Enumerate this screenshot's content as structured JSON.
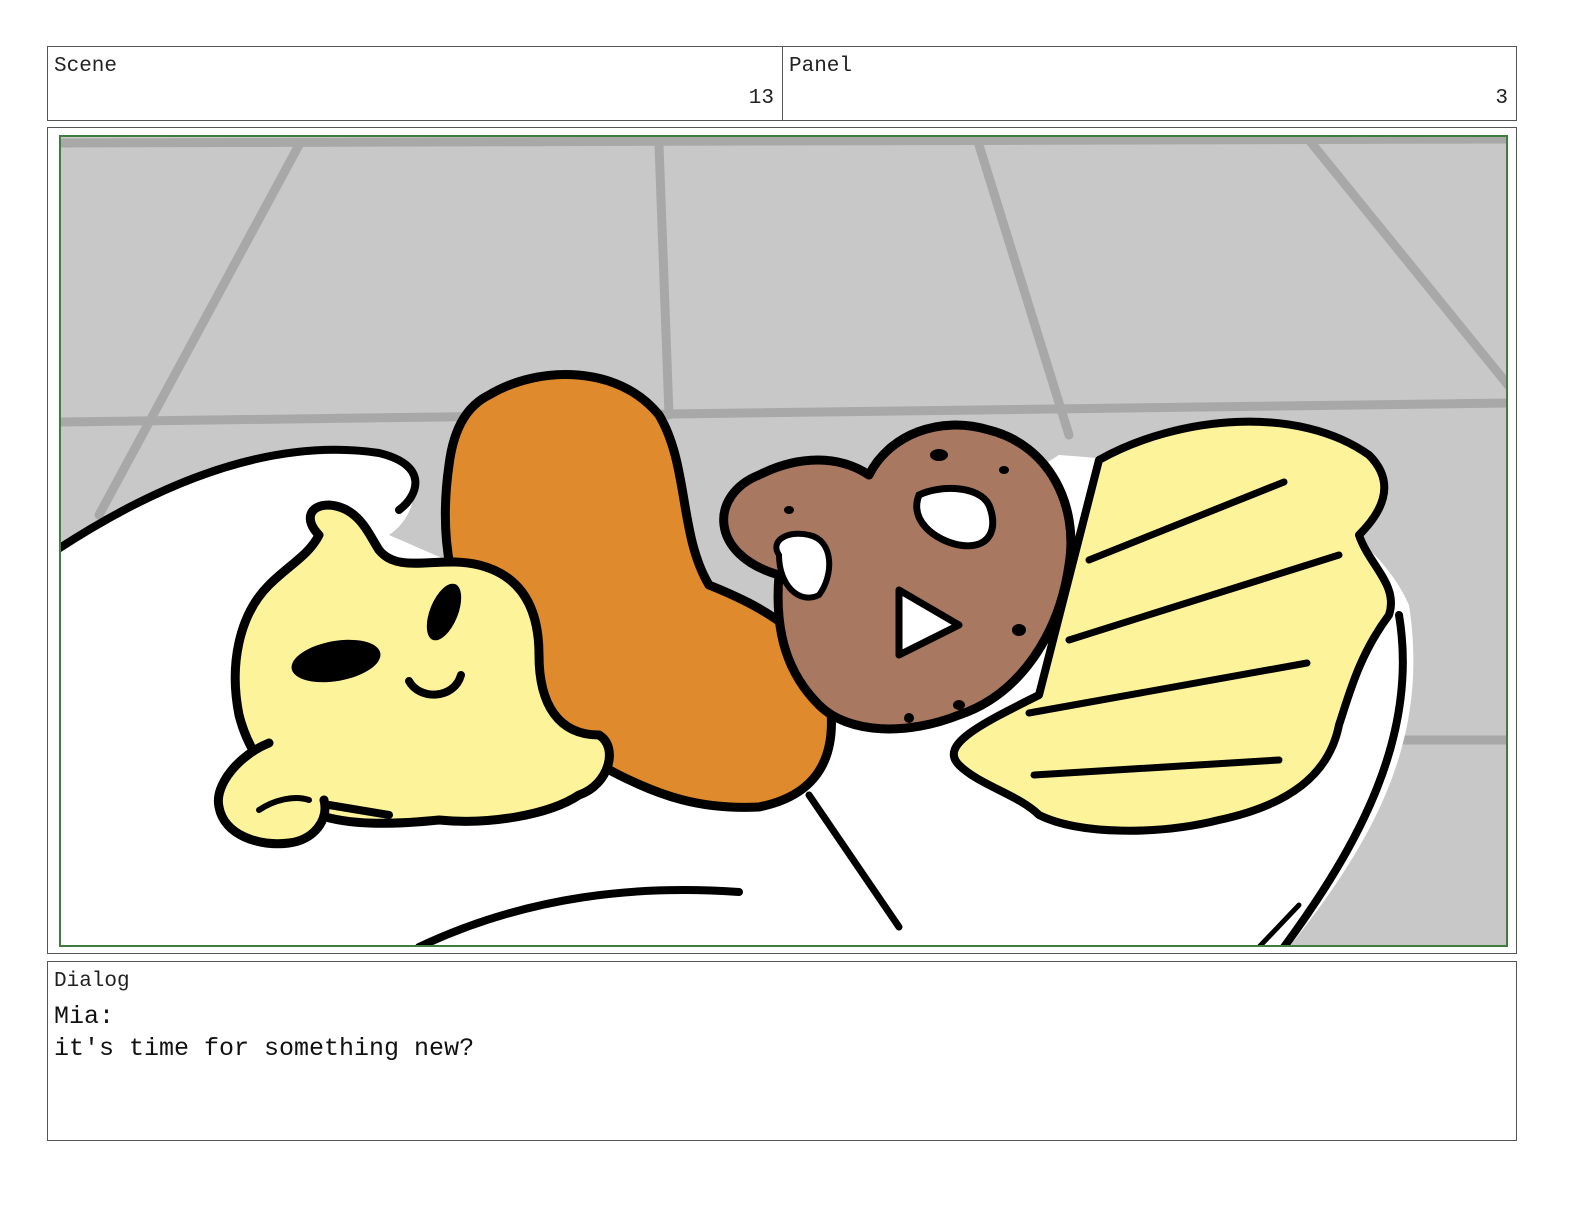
{
  "header": {
    "scene_label": "Scene",
    "scene_number": "13",
    "panel_label": "Panel",
    "panel_number": "3"
  },
  "artwork": {
    "description_icon": "storyboard-sketch",
    "colors": {
      "background_tile": "#c8c8c8",
      "tile_lines": "#a8a8a8",
      "pillow": "#ffffff",
      "bear_fur": "#fdf39a",
      "arm": "#df8a2c",
      "pretzel": "#a87860",
      "blanket": "#fdf39a",
      "outline": "#000000",
      "safe_frame": "#3e7d3e"
    }
  },
  "dialog": {
    "label": "Dialog",
    "speaker": "Mia:",
    "line": "it's time for something new?"
  }
}
